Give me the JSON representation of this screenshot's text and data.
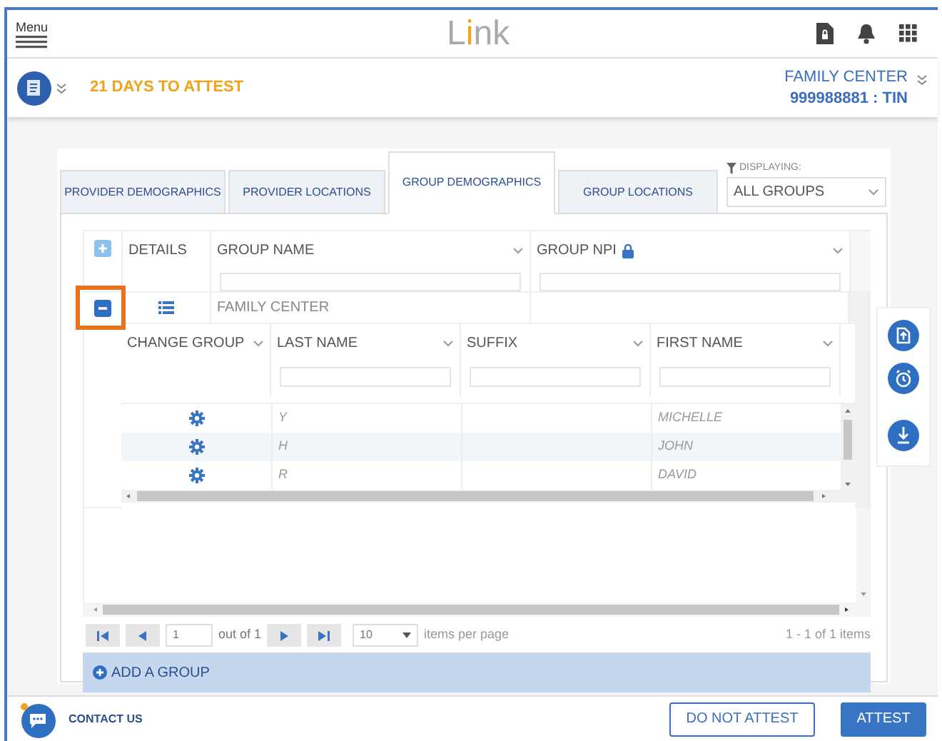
{
  "header": {
    "menu_label": "Menu",
    "logo": "Link"
  },
  "attest_bar": {
    "days": "21 DAYS TO ATTEST",
    "org_name": "FAMILY CENTER",
    "tin": "999988881 : TIN"
  },
  "tabs": [
    {
      "label": "PROVIDER DEMOGRAPHICS",
      "selected": false
    },
    {
      "label": "PROVIDER LOCATIONS",
      "selected": false
    },
    {
      "label": "GROUP DEMOGRAPHICS",
      "selected": true
    },
    {
      "label": "GROUP LOCATIONS",
      "selected": false
    }
  ],
  "filter": {
    "label": "DISPLAYING:",
    "value": "ALL GROUPS"
  },
  "group_grid": {
    "columns": [
      "DETAILS",
      "GROUP NAME",
      "GROUP NPI"
    ],
    "rows": [
      {
        "group_name": "FAMILY CENTER",
        "expanded": true,
        "highlighted": true
      }
    ]
  },
  "provider_grid": {
    "columns": [
      "CHANGE GROUP",
      "LAST NAME",
      "SUFFIX",
      "FIRST NAME"
    ],
    "rows": [
      {
        "last_name": "Y",
        "first_name": "MICHELLE"
      },
      {
        "last_name": "H",
        "first_name": "JOHN"
      },
      {
        "last_name": "R",
        "first_name": "DAVID"
      }
    ]
  },
  "pager": {
    "page": "1",
    "out_of": "out of 1",
    "page_size": "10",
    "per_page_label": "items per page",
    "summary": "1 - 1 of 1 items"
  },
  "add_group": "ADD A GROUP",
  "footer": {
    "contact": "CONTACT US",
    "buttons": [
      "DO NOT ATTEST",
      "ATTEST"
    ]
  }
}
